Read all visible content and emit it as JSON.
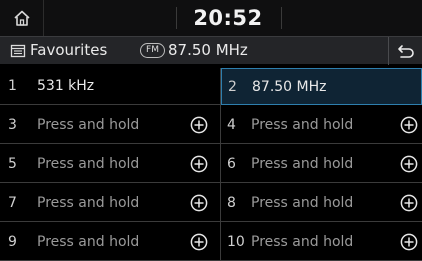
{
  "status_bar": {
    "time": "20:52",
    "home_icon": "home-icon"
  },
  "title_bar": {
    "title": "Favourites",
    "band": "FM",
    "frequency": "87.50 MHz",
    "back_icon": "back-arrow-icon"
  },
  "presets": [
    {
      "number": "1",
      "label": "531 kHz",
      "filled": true,
      "active": false
    },
    {
      "number": "2",
      "label": "87.50 MHz",
      "filled": true,
      "active": true
    },
    {
      "number": "3",
      "label": "Press and hold",
      "filled": false,
      "active": false
    },
    {
      "number": "4",
      "label": "Press and hold",
      "filled": false,
      "active": false
    },
    {
      "number": "5",
      "label": "Press and hold",
      "filled": false,
      "active": false
    },
    {
      "number": "6",
      "label": "Press and hold",
      "filled": false,
      "active": false
    },
    {
      "number": "7",
      "label": "Press and hold",
      "filled": false,
      "active": false
    },
    {
      "number": "8",
      "label": "Press and hold",
      "filled": false,
      "active": false
    },
    {
      "number": "9",
      "label": "Press and hold",
      "filled": false,
      "active": false
    },
    {
      "number": "10",
      "label": "Press and hold",
      "filled": false,
      "active": false
    }
  ],
  "colors": {
    "active_border": "#2e7fae",
    "active_bg": "#0f2434",
    "background": "#000000"
  }
}
